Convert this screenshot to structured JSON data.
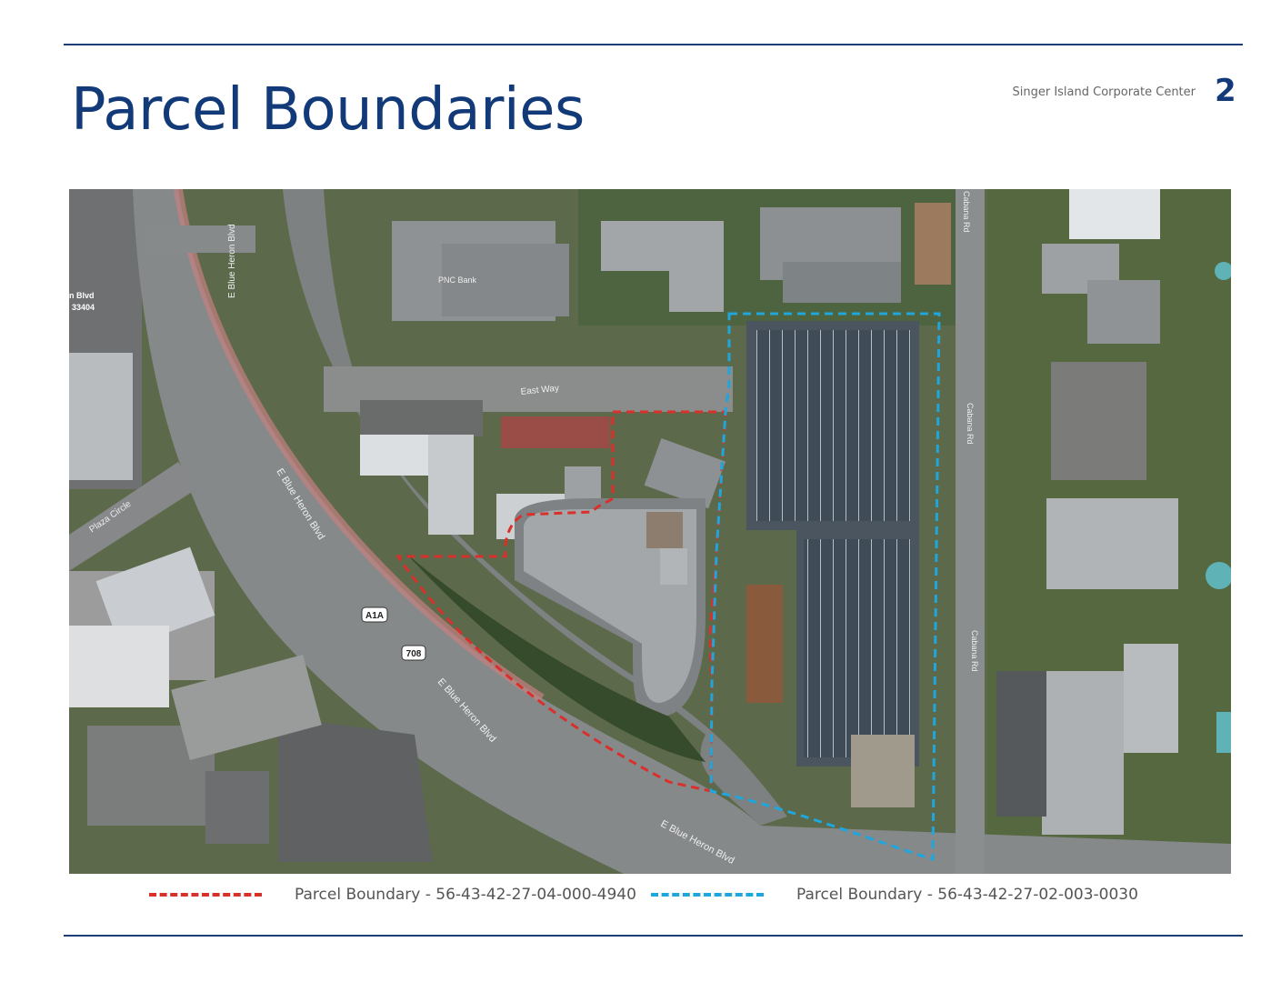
{
  "header": {
    "title": "Parcel Boundaries",
    "project_name": "Singer Island Corporate Center",
    "page_number": "2"
  },
  "map": {
    "street_labels": {
      "e_blue_heron_blvd_1": "E Blue Heron Blvd",
      "e_blue_heron_blvd_2": "E Blue Heron Blvd",
      "e_blue_heron_blvd_3": "E Blue Heron Blvd",
      "e_blue_heron_blvd_4": "E Blue Heron Blvd",
      "east_way": "East Way",
      "cabana_rd_1": "Cabana Rd",
      "cabana_rd_2": "Cabana Rd",
      "cabana_rd_3": "Cabana Rd",
      "plaza_circle": "Plaza Circle",
      "address_line1": "n Blvd",
      "address_line2": "33404"
    },
    "poi_labels": {
      "pnc_bank": "PNC Bank"
    },
    "route_shields": {
      "a1a": "A1A",
      "r708": "708"
    }
  },
  "legend": [
    {
      "label": "Parcel Boundary - 56-43-42-27-04-000-4940",
      "color": "#d9302c"
    },
    {
      "label": "Parcel Boundary - 56-43-42-27-02-003-0030",
      "color": "#1fa6dd"
    }
  ],
  "colors": {
    "brand_blue": "#123a78",
    "rule_blue": "#1d3f77"
  }
}
